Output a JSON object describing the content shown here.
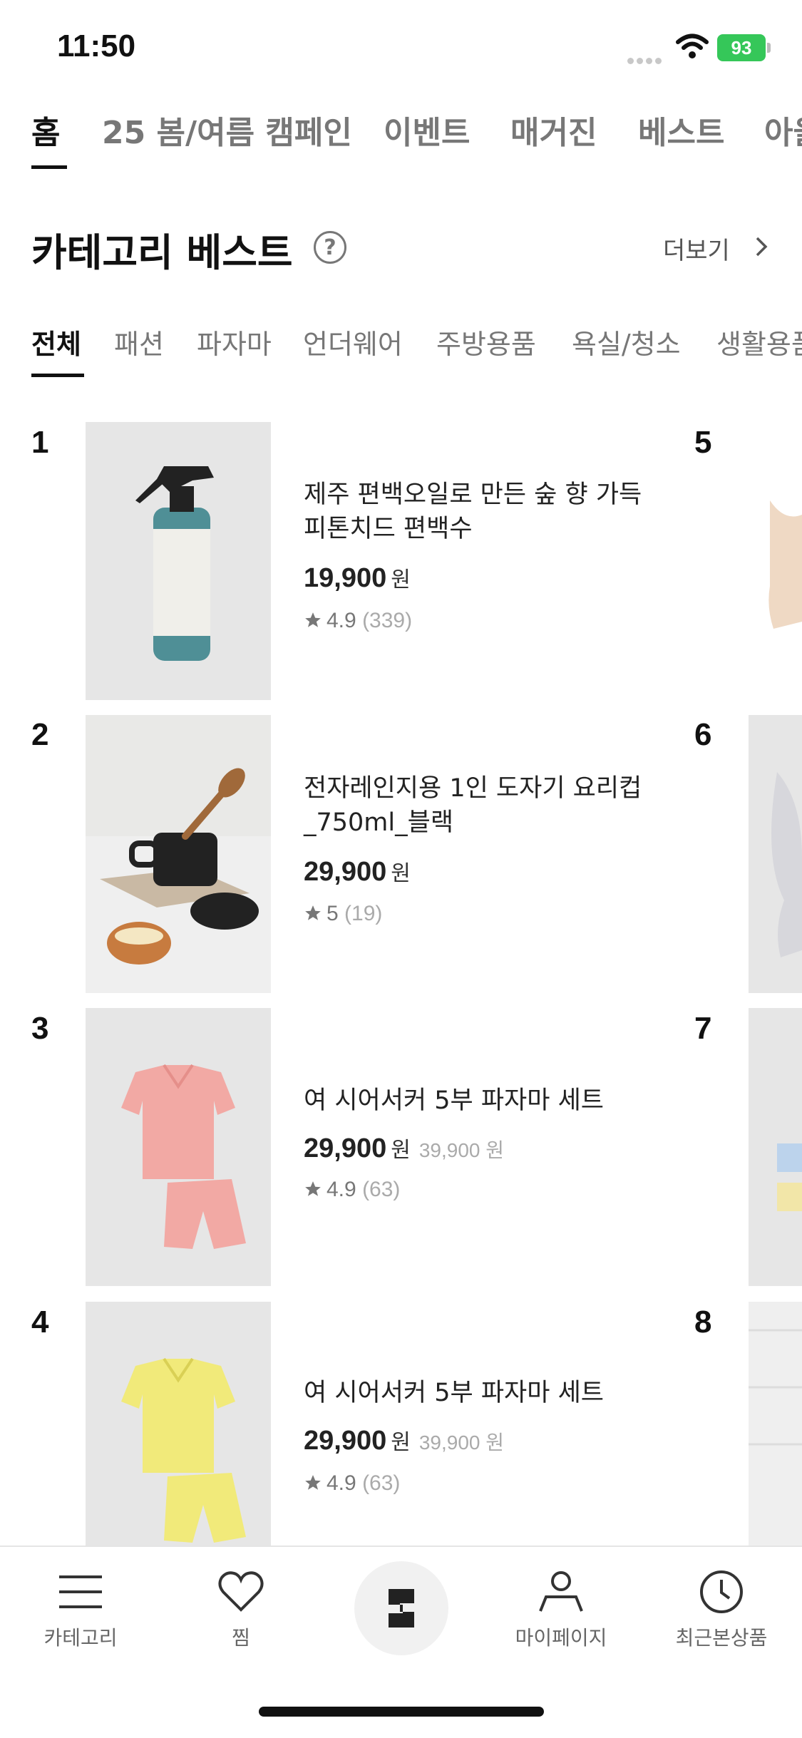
{
  "status_bar": {
    "time": "11:50",
    "battery": "93"
  },
  "top_tabs": [
    "홈",
    "25 봄/여름 캠페인",
    "이벤트",
    "매거진",
    "베스트",
    "아울"
  ],
  "section": {
    "title": "카테고리 베스트",
    "more": "더보기"
  },
  "category_tabs": [
    "전체",
    "패션",
    "파자마",
    "언더웨어",
    "주방용품",
    "욕실/청소",
    "생활용품"
  ],
  "products": [
    {
      "rank": "1",
      "name": "제주 편백오일로 만든 숲 향 가득 피톤치드 편백수",
      "price": "19,900",
      "won": "원",
      "original": "",
      "rating": "4.9",
      "count": "(339)"
    },
    {
      "rank": "2",
      "name": "전자레인지용 1인 도자기 요리컵_750ml_블랙",
      "price": "29,900",
      "won": "원",
      "original": "",
      "rating": "5",
      "count": "(19)"
    },
    {
      "rank": "3",
      "name": "여 시어서커 5부 파자마 세트",
      "price": "29,900",
      "won": "원",
      "original": "39,900 원",
      "rating": "4.9",
      "count": "(63)"
    },
    {
      "rank": "4",
      "name": "여 시어서커 5부 파자마 세트",
      "price": "29,900",
      "won": "원",
      "original": "39,900 원",
      "rating": "4.9",
      "count": "(63)"
    }
  ],
  "right_ranks": [
    "5",
    "6",
    "7",
    "8"
  ],
  "bottom_nav": {
    "category": "카테고리",
    "wish": "찜",
    "mypage": "마이페이지",
    "recent": "최근본상품"
  },
  "icons": [
    "wifi-icon",
    "help-icon",
    "chevron-right-icon",
    "star-icon",
    "menu-icon",
    "heart-icon",
    "brand-logo-icon",
    "person-icon",
    "clock-icon"
  ],
  "colors": {
    "battery": "#35c759",
    "thumb_bg": "#e6e6e6",
    "text": "#111111",
    "muted": "#777777"
  }
}
